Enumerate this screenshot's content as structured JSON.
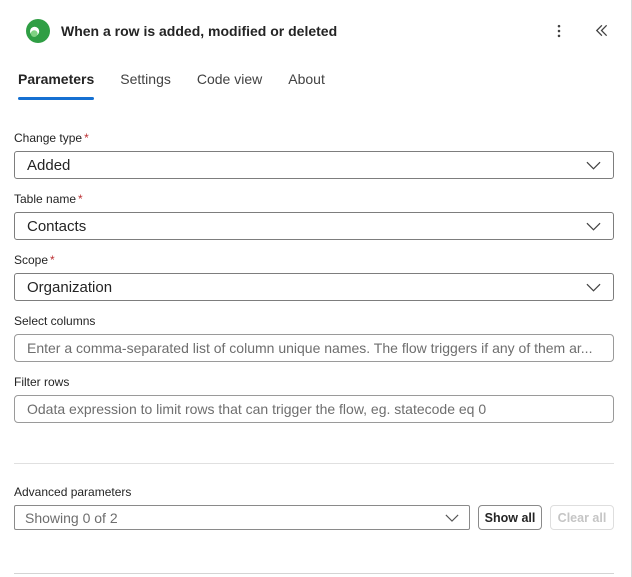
{
  "header": {
    "title": "When a row is added, modified or deleted"
  },
  "tabs": [
    {
      "label": "Parameters",
      "active": true
    },
    {
      "label": "Settings",
      "active": false
    },
    {
      "label": "Code view",
      "active": false
    },
    {
      "label": "About",
      "active": false
    }
  ],
  "fields": [
    {
      "label": "Change type",
      "required_marker": "*",
      "type": "dropdown",
      "value": "Added"
    },
    {
      "label": "Table name",
      "required_marker": "*",
      "type": "dropdown",
      "value": "Contacts"
    },
    {
      "label": "Scope",
      "required_marker": "*",
      "type": "dropdown",
      "value": "Organization"
    },
    {
      "label": "Select columns",
      "required_marker": "",
      "type": "text",
      "placeholder": "Enter a comma-separated list of column unique names. The flow triggers if any of them ar..."
    },
    {
      "label": "Filter rows",
      "required_marker": "",
      "type": "text",
      "placeholder": "Odata expression to limit rows that can trigger the flow, eg. statecode eq 0"
    }
  ],
  "advanced": {
    "label": "Advanced parameters",
    "dropdown_value": "Showing 0 of 2",
    "show_all_label": "Show all",
    "clear_all_label": "Clear all"
  },
  "colors": {
    "accent": "#1570d2",
    "required": "#bc2f32",
    "connector_green": "#2f9e44",
    "connector_green_dark": "#1b7a35",
    "connector_green_light": "#7fd182"
  }
}
